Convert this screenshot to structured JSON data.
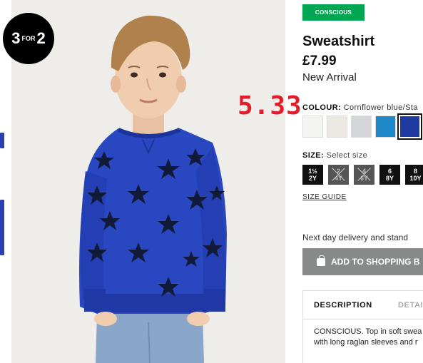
{
  "promo": {
    "big_a": "3",
    "small": "FOR",
    "big_b": "2"
  },
  "annotation": "5.33",
  "product": {
    "tag": "CONSCIOUS",
    "title": "Sweatshirt",
    "price": "£7.99",
    "badge": "New Arrival",
    "colour_label": "COLOUR:",
    "colour_value": "Cornflower blue/Sta",
    "swatches": [
      {
        "name": "white-pattern",
        "color": "#f4f4f2"
      },
      {
        "name": "off-white",
        "color": "#ece9e2"
      },
      {
        "name": "light-grey",
        "color": "#d3d5d9"
      },
      {
        "name": "bright-blue",
        "color": "#1e88c8"
      },
      {
        "name": "cornflower-blue",
        "color": "#1f3aa0"
      }
    ],
    "size_label": "SIZE:",
    "size_value": "Select size",
    "sizes": [
      {
        "top": "1½",
        "bottom": "2Y"
      },
      {
        "top": "2",
        "bottom": "4Y"
      },
      {
        "top": "4",
        "bottom": "6Y"
      },
      {
        "top": "6",
        "bottom": "8Y"
      },
      {
        "top": "8",
        "bottom": "10Y"
      }
    ],
    "size_guide": "SIZE GUIDE",
    "delivery": "Next day delivery and stand",
    "add_button": "ADD TO SHOPPING B",
    "tabs": {
      "description": "DESCRIPTION",
      "details": "DETAI"
    },
    "description_lines": [
      "CONSCIOUS. Top in soft swea",
      "with long raglan sleeves and r"
    ]
  },
  "colors": {
    "accent_green": "#00a651",
    "annotation_red": "#e11d2a",
    "button_grey": "#888a8a"
  }
}
